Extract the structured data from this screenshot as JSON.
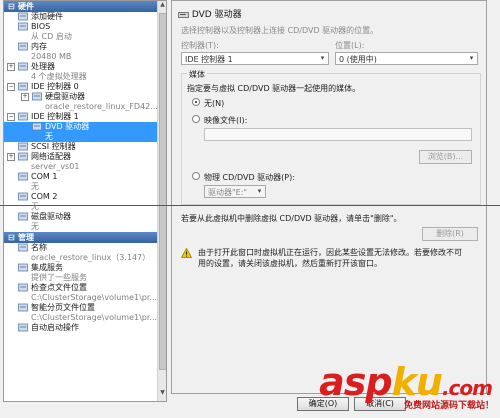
{
  "left_tree": {
    "hardware_header": "硬件",
    "management_header": "管理",
    "hardware_items": [
      {
        "label": "添加硬件",
        "sub": "",
        "icon": "add-hardware-icon",
        "level": 1,
        "expand": ""
      },
      {
        "label": "BIOS",
        "sub": "从 CD 启动",
        "icon": "bios-icon",
        "level": 1,
        "expand": ""
      },
      {
        "label": "内存",
        "sub": "20480 MB",
        "icon": "memory-icon",
        "level": 1,
        "expand": ""
      },
      {
        "label": "处理器",
        "sub": "4 个虚拟处理器",
        "icon": "processor-icon",
        "level": 1,
        "expand": "+"
      },
      {
        "label": "IDE 控制器 0",
        "sub": "",
        "icon": "ide-controller-icon",
        "level": 1,
        "expand": "−"
      },
      {
        "label": "硬盘驱动器",
        "sub": "oracle_restore_linux_FD42...",
        "icon": "hard-drive-icon",
        "level": 2,
        "expand": "+"
      },
      {
        "label": "IDE 控制器 1",
        "sub": "",
        "icon": "ide-controller-icon",
        "level": 1,
        "expand": "−"
      },
      {
        "label": "DVD 驱动器",
        "sub": "无",
        "icon": "dvd-drive-icon",
        "level": 2,
        "expand": "",
        "selected": true
      },
      {
        "label": "SCSI 控制器",
        "sub": "",
        "icon": "scsi-controller-icon",
        "level": 1,
        "expand": ""
      },
      {
        "label": "网络适配器",
        "sub": "server_vs01",
        "icon": "network-adapter-icon",
        "level": 1,
        "expand": "+"
      },
      {
        "label": "COM 1",
        "sub": "无",
        "icon": "com-port-icon",
        "level": 1,
        "expand": ""
      },
      {
        "label": "COM 2",
        "sub": "无",
        "icon": "com-port-icon",
        "level": 1,
        "expand": ""
      },
      {
        "label": "磁盘驱动器",
        "sub": "无",
        "icon": "floppy-drive-icon",
        "level": 1,
        "expand": ""
      }
    ],
    "management_items": [
      {
        "label": "名称",
        "sub": "oracle_restore_linux（3.147）",
        "icon": "name-icon"
      },
      {
        "label": "集成服务",
        "sub": "提供了一些服务",
        "icon": "integration-services-icon"
      },
      {
        "label": "检查点文件位置",
        "sub": "C:\\ClusterStorage\\volume1\\pr...",
        "icon": "checkpoint-folder-icon"
      },
      {
        "label": "智能分页文件位置",
        "sub": "C:\\ClusterStorage\\volume1\\pr...",
        "icon": "paging-folder-icon"
      },
      {
        "label": "自动启动操作",
        "sub": "",
        "icon": "auto-start-icon"
      }
    ]
  },
  "panel": {
    "title": "DVD 驱动器",
    "desc": "选择控制器以及控制器上连接 CD/DVD 驱动器的位置。",
    "controller_label": "控制器(T):",
    "controller_value": "IDE 控制器 1",
    "location_label": "位置(L):",
    "location_value": "0 (使用中)",
    "media_label": "媒体",
    "media_desc": "指定要与虚拟 CD/DVD 驱动器一起使用的媒体。",
    "radio_none": "无(N)",
    "radio_image": "映像文件(I):",
    "browse_button": "浏览(B)...",
    "radio_physical": "物理 CD/DVD 驱动器(P):",
    "physical_value": "驱动器\"E:\"",
    "remove_hint": "若要从此虚拟机中删除虚拟 CD/DVD 驱动器，请单击\"删除\"。",
    "remove_button": "删除(R)",
    "warning_text_1": "由于打开此窗口时虚拟机正在运行，因此某些设置无法修改。若要修改不可",
    "warning_text_2": "用的设置，请关闭该虚拟机，然后重新打开该窗口。",
    "ok_button": "确定(O)",
    "cancel_button": "取消(C)"
  },
  "watermark": {
    "part1": "asp",
    "part2": "ku",
    "part3": ".com",
    "sub": "免费网站源码下载站！"
  },
  "colors": {
    "selection": "#3399ff",
    "header": "#4a77b4",
    "watermark_red": "#d81e1e",
    "annotation_line": "#e02020"
  }
}
